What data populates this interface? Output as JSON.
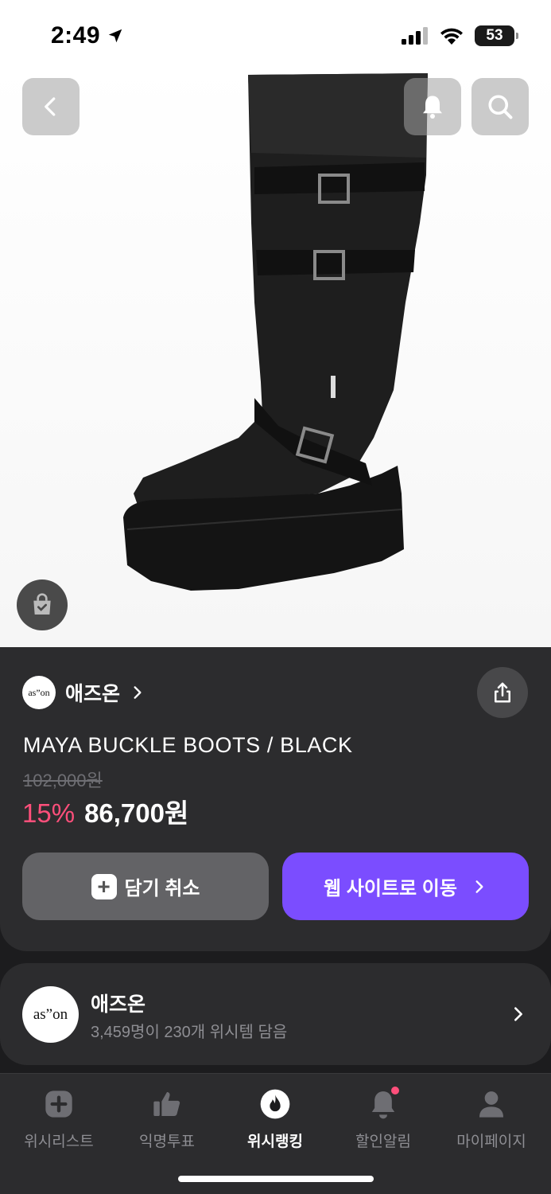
{
  "status_bar": {
    "time": "2:49",
    "battery": "53"
  },
  "product": {
    "brand_name": "애즈온",
    "brand_logo_text": "as”on",
    "title": "MAYA BUCKLE BOOTS  / BLACK",
    "original_price": "102,000원",
    "discount": "15%",
    "sale_price": "86,700원"
  },
  "actions": {
    "cancel_label": "담기 취소",
    "web_label": "웹 사이트로 이동"
  },
  "shop": {
    "name": "애즈온",
    "logo_text": "as”on",
    "stats": "3,459명이 230개 위시템 담음"
  },
  "tabs": [
    {
      "label": "위시리스트",
      "icon": "plus-square-icon"
    },
    {
      "label": "익명투표",
      "icon": "thumbs-up-icon"
    },
    {
      "label": "위시랭킹",
      "icon": "flame-icon",
      "active": true
    },
    {
      "label": "할인알림",
      "icon": "bell-icon",
      "badge": true
    },
    {
      "label": "마이페이지",
      "icon": "person-icon"
    }
  ],
  "colors": {
    "accent": "#7b4dff",
    "discount": "#ff4f7b",
    "card": "#2c2c2e",
    "background": "#1c1c1e"
  }
}
